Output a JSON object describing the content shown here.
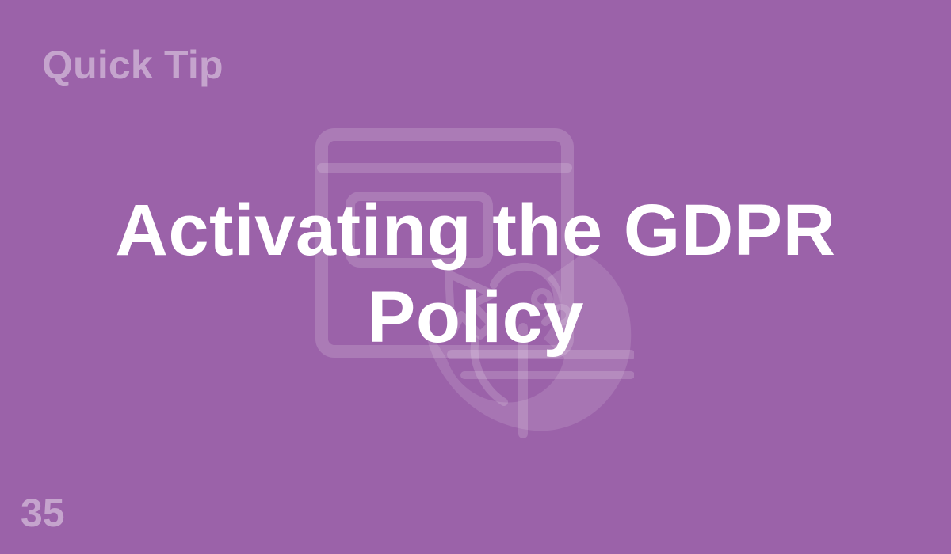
{
  "card": {
    "eyebrow": "Quick Tip",
    "title_lines": [
      "Activating the GDPR",
      "Policy"
    ],
    "number": "35"
  },
  "icons": {
    "illustration": "browser-window-with-cursor-and-globe-icon"
  },
  "colors": {
    "background": "#9b62a9",
    "title": "#ffffff",
    "muted_text": "rgba(255,255,255,0.42)",
    "illustration": "rgba(255,255,255,0.16)"
  }
}
